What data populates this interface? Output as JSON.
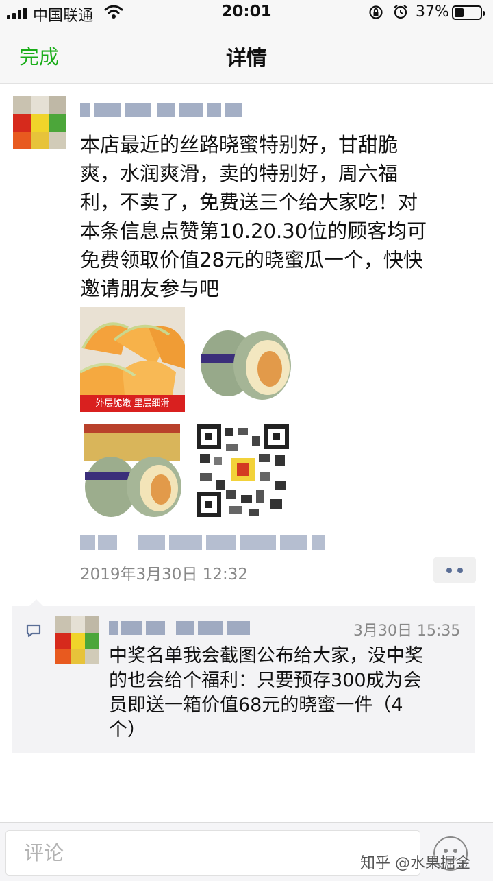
{
  "status_bar": {
    "carrier": "中国联通",
    "time": "20:01",
    "battery": "37%",
    "battery_level": 0.37
  },
  "nav": {
    "done_label": "完成",
    "title": "详情"
  },
  "post": {
    "text": "本店最近的丝路晓蜜特别好，甘甜脆\n爽，水润爽滑，卖的特别好，周六福\n利，不卖了，免费送三个给大家吃！对\n本条信息点赞第10.20.30位的顾客均可\n免费领取价值28元的晓蜜瓜一个，快快\n邀请朋友参与吧",
    "photo_caption": "外层脆嫩  里层细滑",
    "time": "2019年3月30日 12:32"
  },
  "comment": {
    "time": "3月30日 15:35",
    "text": "中奖名单我会截图公布给大家，没中奖\n的也会给个福利：只要预存300成为会\n员即送一箱价值68元的晓蜜一件（4\n个）"
  },
  "input": {
    "placeholder": "评论"
  },
  "watermark": "知乎 @水果掘金",
  "colors": {
    "accent_green": "#1aad19",
    "link_blue": "#5a6e96"
  }
}
